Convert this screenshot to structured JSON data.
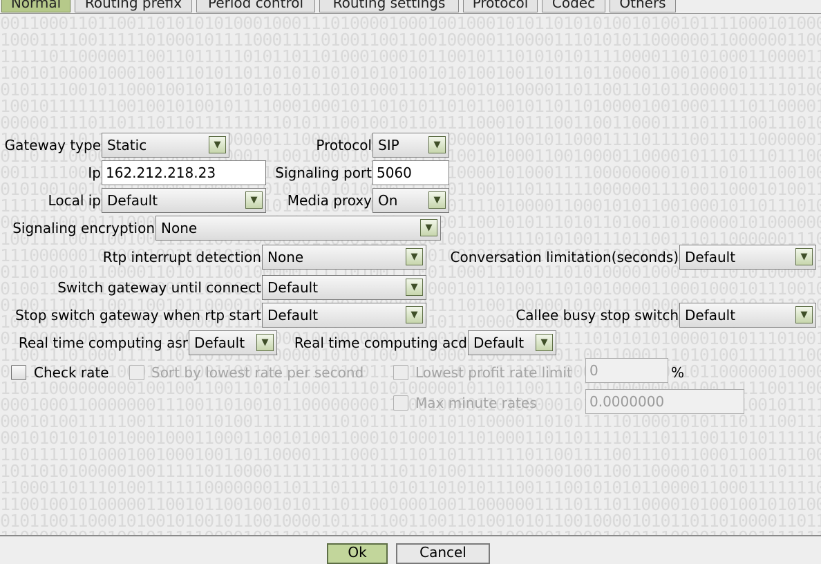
{
  "tabs": [
    "Normal",
    "Routing prefix",
    "Period control",
    "Routing settings",
    "Protocol",
    "Codec",
    "Others"
  ],
  "form": {
    "gateway_type": {
      "label": "Gateway type",
      "value": "Static"
    },
    "protocol": {
      "label": "Protocol",
      "value": "SIP"
    },
    "ip": {
      "label": "Ip",
      "value": "162.212.218.23"
    },
    "signaling_port": {
      "label": "Signaling port",
      "value": "5060"
    },
    "local_ip": {
      "label": "Local ip",
      "value": "Default"
    },
    "media_proxy": {
      "label": "Media proxy",
      "value": "On"
    },
    "signaling_encryption": {
      "label": "Signaling encryption",
      "value": "None"
    },
    "rtp_interrupt_detection": {
      "label": "Rtp interrupt detection",
      "value": "None"
    },
    "conversation_limitation": {
      "label": "Conversation limitation(seconds)",
      "value": "Default"
    },
    "switch_gateway_until_connect": {
      "label": "Switch gateway until connect",
      "value": "Default"
    },
    "stop_switch_gateway_when_rtp_start": {
      "label": "Stop switch gateway when rtp start",
      "value": "Default"
    },
    "callee_busy_stop_switch": {
      "label": "Callee busy stop switch",
      "value": "Default"
    },
    "real_time_computing_asr": {
      "label": "Real time computing asr",
      "value": "Default"
    },
    "real_time_computing_acd": {
      "label": "Real time computing acd",
      "value": "Default"
    }
  },
  "checks": {
    "check_rate": "Check rate",
    "sort_by_lowest_rate": "Sort by lowest rate per second",
    "lowest_profit_rate_limit": "Lowest profit rate limit",
    "lowest_profit_value": "0",
    "percent_sign": "%",
    "max_minute_rates": "Max minute rates",
    "max_minute_rates_value": "0.0000000"
  },
  "dropdown_glyph": "▼",
  "buttons": {
    "ok": "Ok",
    "cancel": "Cancel"
  }
}
